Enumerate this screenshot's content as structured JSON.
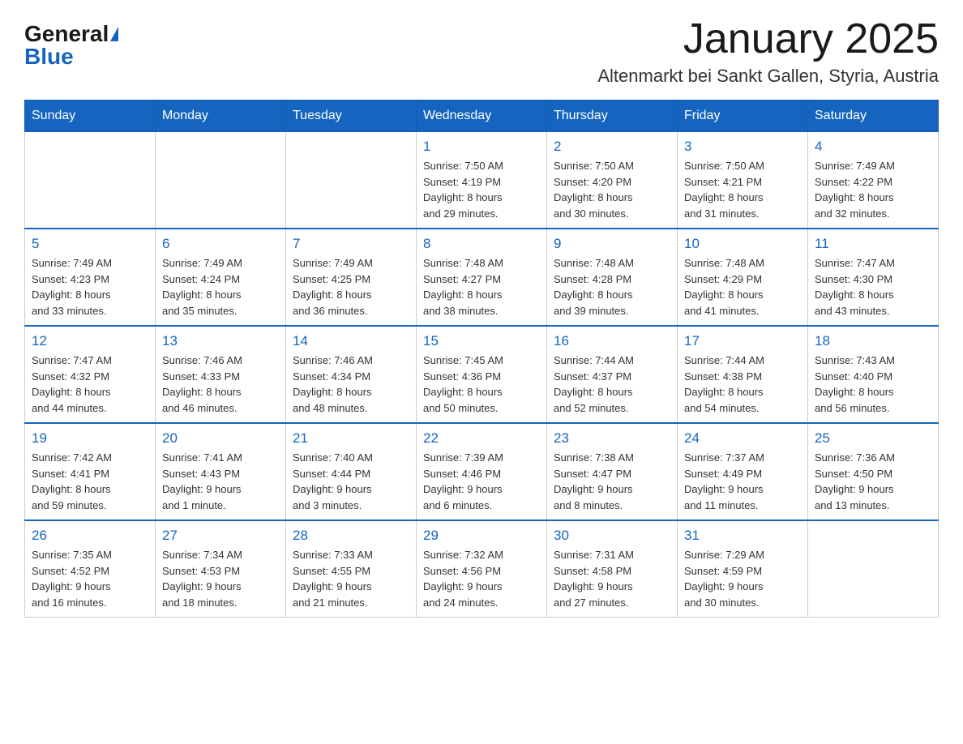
{
  "logo": {
    "general": "General",
    "blue": "Blue"
  },
  "header": {
    "month_year": "January 2025",
    "location": "Altenmarkt bei Sankt Gallen, Styria, Austria"
  },
  "weekdays": [
    "Sunday",
    "Monday",
    "Tuesday",
    "Wednesday",
    "Thursday",
    "Friday",
    "Saturday"
  ],
  "weeks": [
    [
      {
        "day": "",
        "info": ""
      },
      {
        "day": "",
        "info": ""
      },
      {
        "day": "",
        "info": ""
      },
      {
        "day": "1",
        "info": "Sunrise: 7:50 AM\nSunset: 4:19 PM\nDaylight: 8 hours\nand 29 minutes."
      },
      {
        "day": "2",
        "info": "Sunrise: 7:50 AM\nSunset: 4:20 PM\nDaylight: 8 hours\nand 30 minutes."
      },
      {
        "day": "3",
        "info": "Sunrise: 7:50 AM\nSunset: 4:21 PM\nDaylight: 8 hours\nand 31 minutes."
      },
      {
        "day": "4",
        "info": "Sunrise: 7:49 AM\nSunset: 4:22 PM\nDaylight: 8 hours\nand 32 minutes."
      }
    ],
    [
      {
        "day": "5",
        "info": "Sunrise: 7:49 AM\nSunset: 4:23 PM\nDaylight: 8 hours\nand 33 minutes."
      },
      {
        "day": "6",
        "info": "Sunrise: 7:49 AM\nSunset: 4:24 PM\nDaylight: 8 hours\nand 35 minutes."
      },
      {
        "day": "7",
        "info": "Sunrise: 7:49 AM\nSunset: 4:25 PM\nDaylight: 8 hours\nand 36 minutes."
      },
      {
        "day": "8",
        "info": "Sunrise: 7:48 AM\nSunset: 4:27 PM\nDaylight: 8 hours\nand 38 minutes."
      },
      {
        "day": "9",
        "info": "Sunrise: 7:48 AM\nSunset: 4:28 PM\nDaylight: 8 hours\nand 39 minutes."
      },
      {
        "day": "10",
        "info": "Sunrise: 7:48 AM\nSunset: 4:29 PM\nDaylight: 8 hours\nand 41 minutes."
      },
      {
        "day": "11",
        "info": "Sunrise: 7:47 AM\nSunset: 4:30 PM\nDaylight: 8 hours\nand 43 minutes."
      }
    ],
    [
      {
        "day": "12",
        "info": "Sunrise: 7:47 AM\nSunset: 4:32 PM\nDaylight: 8 hours\nand 44 minutes."
      },
      {
        "day": "13",
        "info": "Sunrise: 7:46 AM\nSunset: 4:33 PM\nDaylight: 8 hours\nand 46 minutes."
      },
      {
        "day": "14",
        "info": "Sunrise: 7:46 AM\nSunset: 4:34 PM\nDaylight: 8 hours\nand 48 minutes."
      },
      {
        "day": "15",
        "info": "Sunrise: 7:45 AM\nSunset: 4:36 PM\nDaylight: 8 hours\nand 50 minutes."
      },
      {
        "day": "16",
        "info": "Sunrise: 7:44 AM\nSunset: 4:37 PM\nDaylight: 8 hours\nand 52 minutes."
      },
      {
        "day": "17",
        "info": "Sunrise: 7:44 AM\nSunset: 4:38 PM\nDaylight: 8 hours\nand 54 minutes."
      },
      {
        "day": "18",
        "info": "Sunrise: 7:43 AM\nSunset: 4:40 PM\nDaylight: 8 hours\nand 56 minutes."
      }
    ],
    [
      {
        "day": "19",
        "info": "Sunrise: 7:42 AM\nSunset: 4:41 PM\nDaylight: 8 hours\nand 59 minutes."
      },
      {
        "day": "20",
        "info": "Sunrise: 7:41 AM\nSunset: 4:43 PM\nDaylight: 9 hours\nand 1 minute."
      },
      {
        "day": "21",
        "info": "Sunrise: 7:40 AM\nSunset: 4:44 PM\nDaylight: 9 hours\nand 3 minutes."
      },
      {
        "day": "22",
        "info": "Sunrise: 7:39 AM\nSunset: 4:46 PM\nDaylight: 9 hours\nand 6 minutes."
      },
      {
        "day": "23",
        "info": "Sunrise: 7:38 AM\nSunset: 4:47 PM\nDaylight: 9 hours\nand 8 minutes."
      },
      {
        "day": "24",
        "info": "Sunrise: 7:37 AM\nSunset: 4:49 PM\nDaylight: 9 hours\nand 11 minutes."
      },
      {
        "day": "25",
        "info": "Sunrise: 7:36 AM\nSunset: 4:50 PM\nDaylight: 9 hours\nand 13 minutes."
      }
    ],
    [
      {
        "day": "26",
        "info": "Sunrise: 7:35 AM\nSunset: 4:52 PM\nDaylight: 9 hours\nand 16 minutes."
      },
      {
        "day": "27",
        "info": "Sunrise: 7:34 AM\nSunset: 4:53 PM\nDaylight: 9 hours\nand 18 minutes."
      },
      {
        "day": "28",
        "info": "Sunrise: 7:33 AM\nSunset: 4:55 PM\nDaylight: 9 hours\nand 21 minutes."
      },
      {
        "day": "29",
        "info": "Sunrise: 7:32 AM\nSunset: 4:56 PM\nDaylight: 9 hours\nand 24 minutes."
      },
      {
        "day": "30",
        "info": "Sunrise: 7:31 AM\nSunset: 4:58 PM\nDaylight: 9 hours\nand 27 minutes."
      },
      {
        "day": "31",
        "info": "Sunrise: 7:29 AM\nSunset: 4:59 PM\nDaylight: 9 hours\nand 30 minutes."
      },
      {
        "day": "",
        "info": ""
      }
    ]
  ]
}
